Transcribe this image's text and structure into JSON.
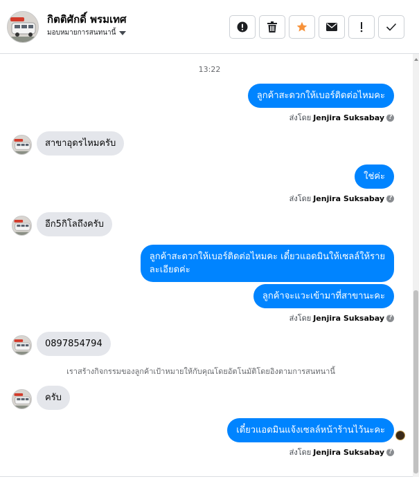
{
  "header": {
    "contact_name": "กิตติศักดิ์ พรมเทศ",
    "assign_label": "มอบหมายการสนทนานี้",
    "toolbar": [
      {
        "name": "report-spam-button",
        "icon": "exclamation-circle-icon"
      },
      {
        "name": "delete-button",
        "icon": "trash-icon"
      },
      {
        "name": "star-button",
        "icon": "star-icon"
      },
      {
        "name": "mark-unread-button",
        "icon": "envelope-icon"
      },
      {
        "name": "follow-up-button",
        "icon": "exclamation-icon"
      },
      {
        "name": "mark-done-button",
        "icon": "checkmark-icon"
      }
    ]
  },
  "chat": {
    "timestamp": "13:22",
    "messages": [
      {
        "id": "m1",
        "direction": "out",
        "text": "ลูกค้าสะดวกให้เบอร์ติดต่อไหมคะ"
      },
      {
        "id": "s1",
        "sender_prefix": "ส่งโดย",
        "sender_name": "Jenjira Suksabay"
      },
      {
        "id": "m2",
        "direction": "in",
        "text": "สาขาอุดรไหมครับ"
      },
      {
        "id": "m3",
        "direction": "out",
        "text": "ใช่ค่ะ"
      },
      {
        "id": "s2",
        "sender_prefix": "ส่งโดย",
        "sender_name": "Jenjira Suksabay"
      },
      {
        "id": "m4",
        "direction": "in",
        "text": "อีก5กิโลถึงครับ"
      },
      {
        "id": "m5",
        "direction": "out",
        "text_line1": "ลูกค้าสะดวกให้เบอร์ติดต่อไหมคะ เดี๋ยวแอดมินให้เซลล์ให้ราย",
        "text_line2": "ละเอียดค่ะ"
      },
      {
        "id": "m6",
        "direction": "out",
        "text": "ลูกค้าจะแวะเข้ามาที่สาขานะคะ"
      },
      {
        "id": "s3",
        "sender_prefix": "ส่งโดย",
        "sender_name": "Jenjira Suksabay"
      },
      {
        "id": "m7",
        "direction": "in",
        "text": "0897854794"
      },
      {
        "id": "sys1",
        "text": "เราสร้างกิจกรรมของลูกค้าเป้าหมายให้กับคุณโดยอัตโนมัติโดยอิงตามการสนทนานี้"
      },
      {
        "id": "m8",
        "direction": "in",
        "text": "ครับ"
      },
      {
        "id": "m9",
        "direction": "out",
        "text": "เดี๋ยวแอดมินแจ้งเซลล์หน้าร้านไว้นะคะ"
      },
      {
        "id": "s4",
        "sender_prefix": "ส่งโดย",
        "sender_name": "Jenjira Suksabay"
      }
    ]
  },
  "colors": {
    "outgoing_bubble": "#0084ff",
    "incoming_bubble": "#e4e6eb",
    "star_accent": "#f7923a"
  }
}
